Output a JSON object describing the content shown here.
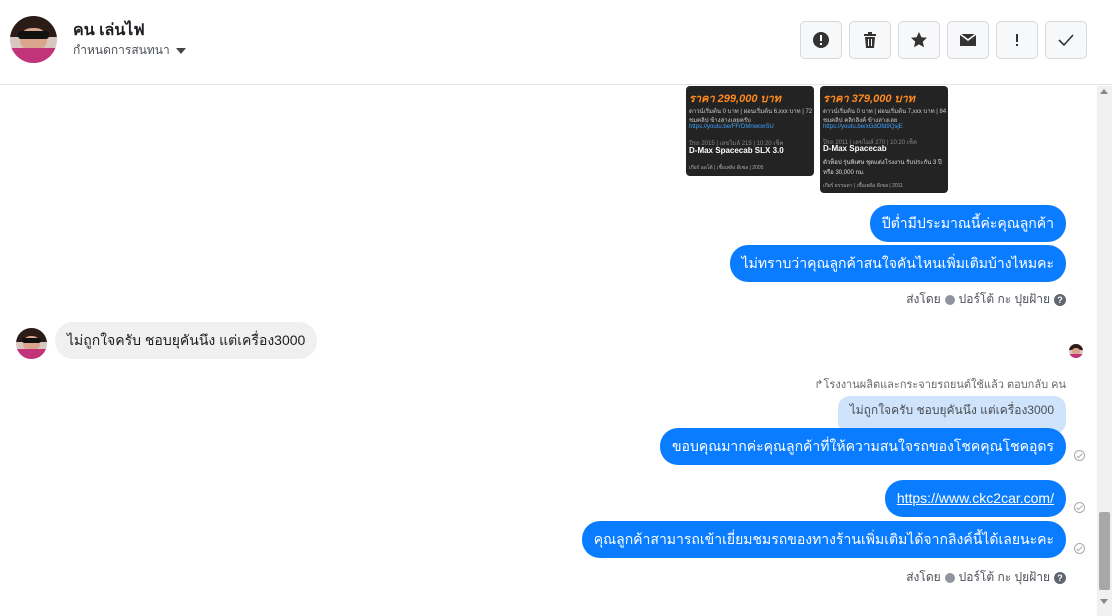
{
  "header": {
    "name": "คน เล่นไฟ",
    "subtitle": "กำหนดการสนทนา",
    "toolbar": [
      "alert-circle-icon",
      "trash-icon",
      "star-icon",
      "envelope-icon",
      "exclamation-icon",
      "check-icon"
    ]
  },
  "ads": [
    {
      "price": "ราคา 299,000 บาท",
      "line1": "ดาวน์เริ่มต้น 0 บาท | ผ่อนเริ่มต้น 6,xxx บาท | 72 งวด",
      "line2": "ชมคลิป ข้างล่างเลยครับ",
      "link": "https://youtu.be/FFrDMnwcwSU",
      "meta": "ปีรถ 2015 | เลขไมล์ 215 | 10:20 เช็ค",
      "model": "D-Max Spacecab SLX 3.0",
      "footer": "เกียร์ ออโต้ | เชื้อเพลิง ดีเซล | 2005"
    },
    {
      "price": "ราคา 379,000 บาท",
      "line1": "ดาวน์เริ่มต้น 0 บาท | ผ่อนเริ่มต้น 7,xxx บาท | 84 งวด",
      "line2": "ชมคลิป คลิกลิงค์ ข้างล่างเลย",
      "link": "https://youtu.be/xGdOfd9QsjE",
      "meta": "ปีรถ 2011 | เลขไมล์ 270 | 10:20 เช็ค",
      "model": "D-Max Spacecab",
      "note": "ตัวท็อป รุ่นพิเศษ ชุดแต่งโรงงาน รับประกัน 3 ปี หรือ 30,000 กม.",
      "footer": "เกียร์ ธรรมดา | เชื้อเพลิง ดีเซล | 2011"
    }
  ],
  "messages": {
    "out1": "ปีต่ำมีประมาณนี้ค่ะคุณลูกค้า",
    "out2": "ไม่ทราบว่าคุณลูกค้าสนใจคันไหนเพิ่มเติมบ้างไหมคะ",
    "sent_by_1": "ส่งโดย",
    "sender_1": "ปอร์โต้ กะ ปุยฝ้าย",
    "in1": "ไม่ถูกใจครับ ชอบยุคันนึง แต่เครื่อง3000",
    "reply_note": "โรงงานผลิตและกระจายรถยนต์ใช้แล้ว ตอบกลับ คน",
    "reply_quote": "ไม่ถูกใจครับ ชอบยุคันนึง แต่เครื่อง3000",
    "out3": "ขอบคุณมากค่ะคุณลูกค้าที่ให้ความสนใจรถของโชคคุณโชคอุดร",
    "out4": "https://www.ckc2car.com/",
    "out5": "คุณลูกค้าสามารถเข้าเยี่ยมชมรถของทางร้านเพิ่มเติมได้จากลิงค์นี้ได้เลยนะคะ",
    "sent_by_2": "ส่งโดย",
    "sender_2": "ปอร์โต้ กะ ปุยฝ้าย"
  }
}
